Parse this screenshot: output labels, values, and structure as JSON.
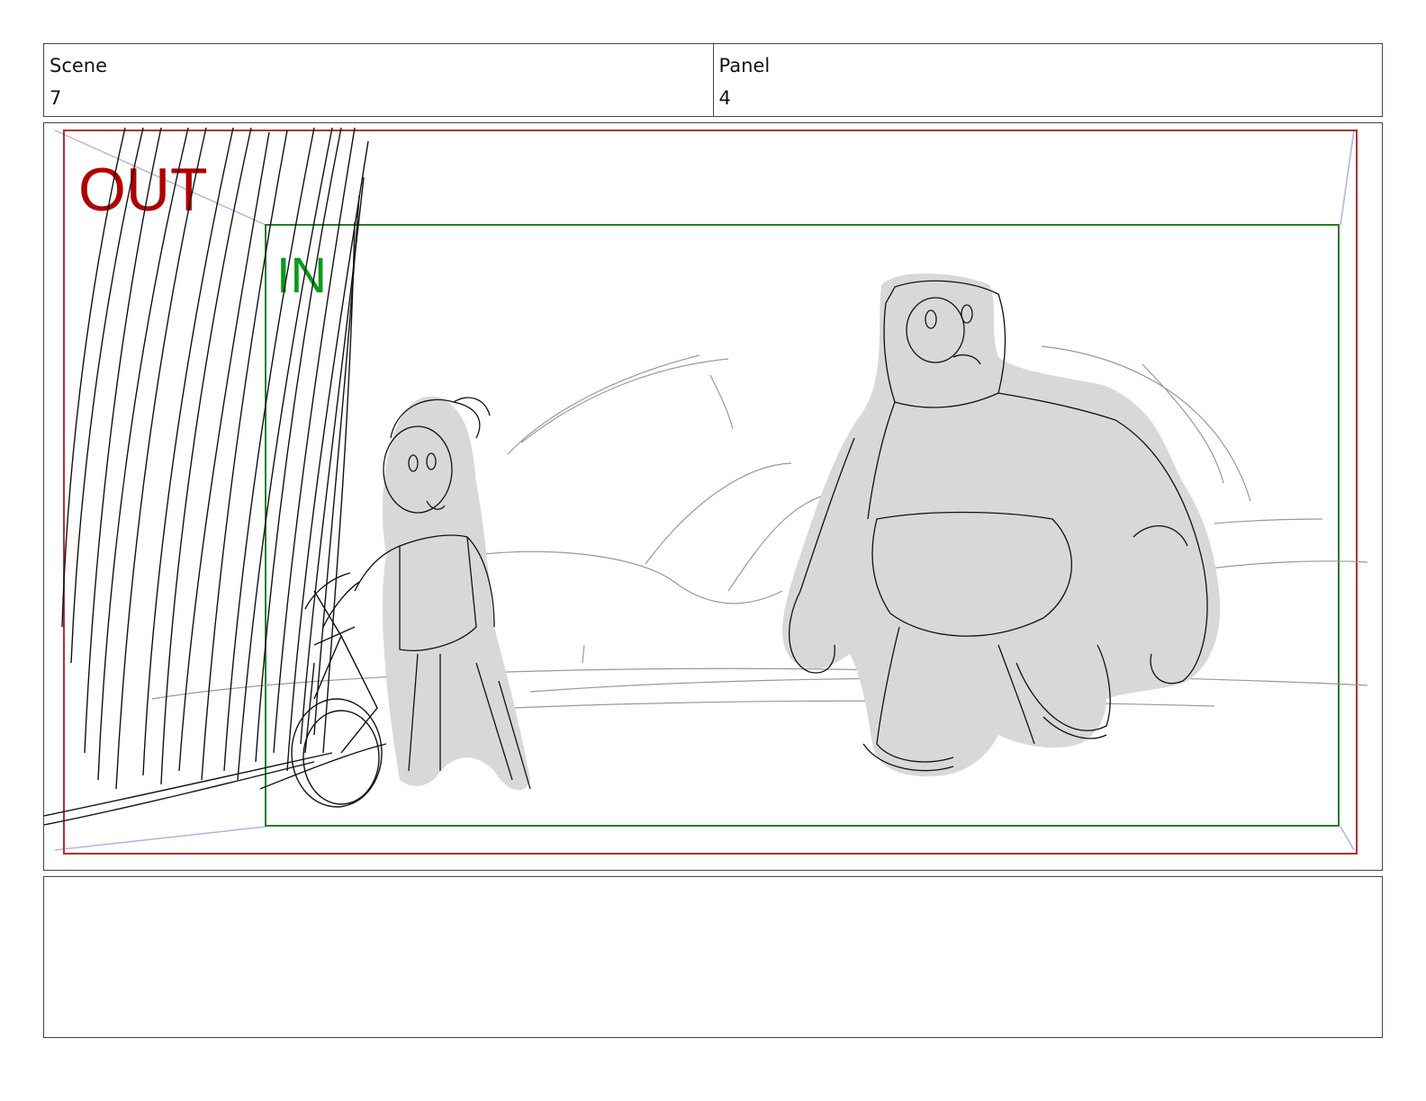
{
  "header": {
    "scene_label": "Scene",
    "scene_value": "7",
    "panel_label": "Panel",
    "panel_value": "4"
  },
  "frame": {
    "out_label": "OUT",
    "in_label": "IN",
    "out_color": "#b00000",
    "in_color": "#0a9a1a",
    "out_border_color": "#b03030",
    "in_border_color": "#2a7a2a"
  },
  "notes": {
    "text": ""
  }
}
